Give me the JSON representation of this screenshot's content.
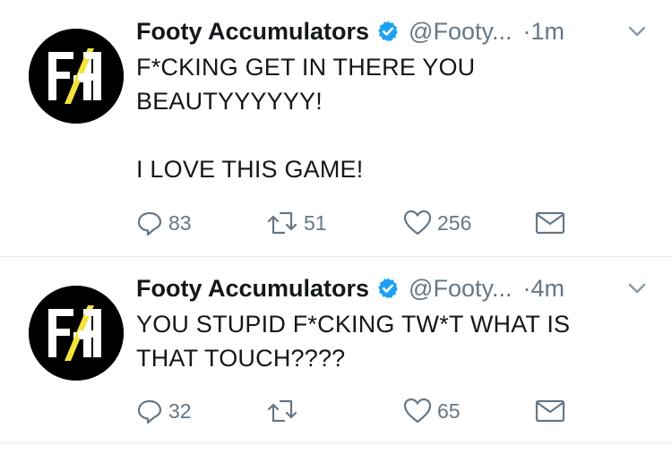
{
  "tweets": [
    {
      "name": "Footy Accumulators",
      "handle": "@Footy...",
      "dot": "·",
      "time": "1m",
      "text": "F*CKING GET IN THERE YOU\nBEAUTYYYYYY!\n\nI LOVE THIS GAME!",
      "replies": "83",
      "retweets": "51",
      "likes": "256"
    },
    {
      "name": "Footy Accumulators",
      "handle": "@Footy...",
      "dot": "·",
      "time": "4m",
      "text": "YOU STUPID F*CKING TW*T WHAT IS\nTHAT TOUCH????",
      "replies": "32",
      "retweets": "",
      "likes": "65"
    }
  ],
  "avatar_logo": "FA",
  "colors": {
    "verified": "#1da1f2",
    "secondary_text": "#657786",
    "logo_accent": "#f4e23a"
  }
}
